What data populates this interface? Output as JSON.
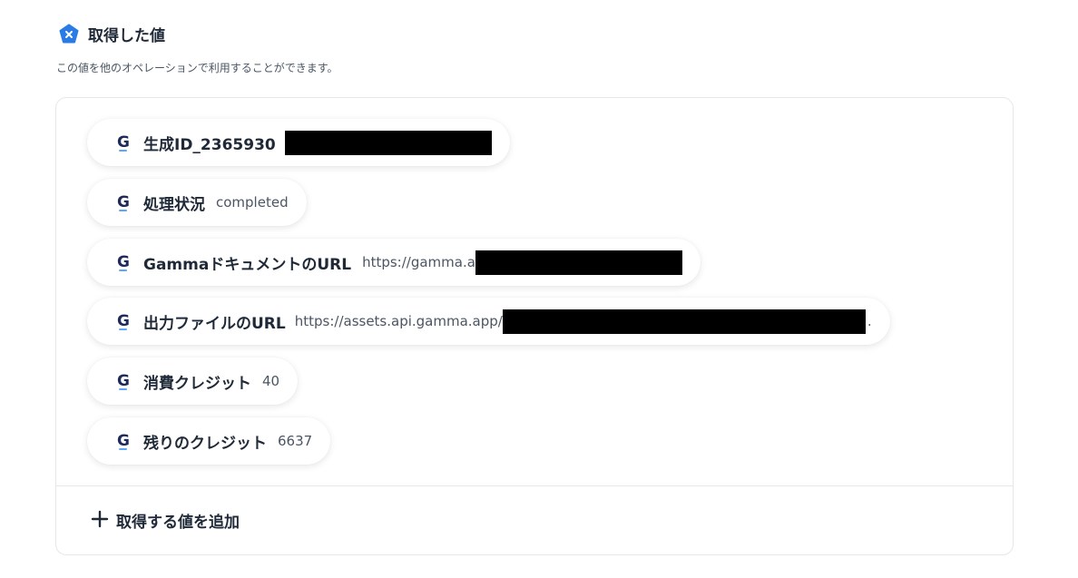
{
  "header": {
    "title": "取得した値",
    "badge_icon": "x-icon",
    "badge_color": "#2B7BE6",
    "description": "この値を他のオペレーションで利用することができます。"
  },
  "chips": [
    {
      "label": "生成ID_2365930",
      "value": "",
      "icon": "gamma-g-icon"
    },
    {
      "label": "処理状況",
      "value": "completed",
      "icon": "gamma-g-icon"
    },
    {
      "label": "GammaドキュメントのURL",
      "value": "https://gamma.a",
      "icon": "gamma-g-icon"
    },
    {
      "label": "出力ファイルのURL",
      "value": "https://assets.api.gamma.app/",
      "value_suffix": ".",
      "icon": "gamma-g-icon"
    },
    {
      "label": "消費クレジット",
      "value": "40",
      "icon": "gamma-g-icon"
    },
    {
      "label": "残りのクレジット",
      "value": "6637",
      "icon": "gamma-g-icon"
    }
  ],
  "add_button": {
    "label": "取得する値を追加",
    "icon": "plus-icon"
  },
  "colors": {
    "icon_navy": "#1e2a5a",
    "icon_accent": "#60a5fa"
  }
}
